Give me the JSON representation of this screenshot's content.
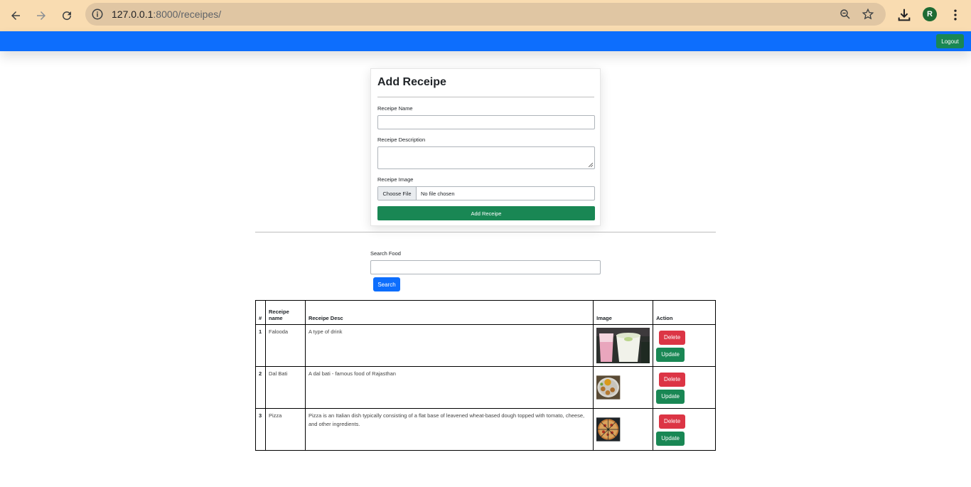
{
  "browser": {
    "url_host": "127.0.0.1",
    "url_rest": ":8000/receipes/",
    "avatar_letter": "R"
  },
  "navbar": {
    "logout_label": "Logout",
    "bg_color": "#0d6efd"
  },
  "form": {
    "title": "Add Receipe",
    "name_label": "Receipe Name",
    "name_value": "",
    "desc_label": "Receipe Description",
    "desc_value": "",
    "image_label": "Receipe Image",
    "choose_file_label": "Choose File",
    "no_file_text": "No file chosen",
    "submit_label": "Add Receipe"
  },
  "search": {
    "label": "Search Food",
    "value": "",
    "button_label": "Search"
  },
  "table": {
    "headers": [
      "#",
      "Receipe name",
      "Receipe Desc",
      "Image",
      "Action"
    ],
    "rows": [
      {
        "num": "1",
        "name": "Falooda",
        "desc": "A type of drink",
        "image": "falooda-photo"
      },
      {
        "num": "2",
        "name": "Dal Bati",
        "desc": "A dal bati - famous food of Rajasthan",
        "image": "dal-bati-photo"
      },
      {
        "num": "3",
        "name": "Pizza",
        "desc": "Pizza is an Italian dish typically consisting of a flat base of leavened wheat-based dough topped with tomato, cheese, and other ingredients.",
        "image": "pizza-photo"
      }
    ],
    "delete_label": "Delete",
    "update_label": "Update"
  },
  "colors": {
    "chrome": "#f9dcb1",
    "success": "#198754",
    "danger": "#dc3545",
    "primary": "#0d6efd"
  }
}
